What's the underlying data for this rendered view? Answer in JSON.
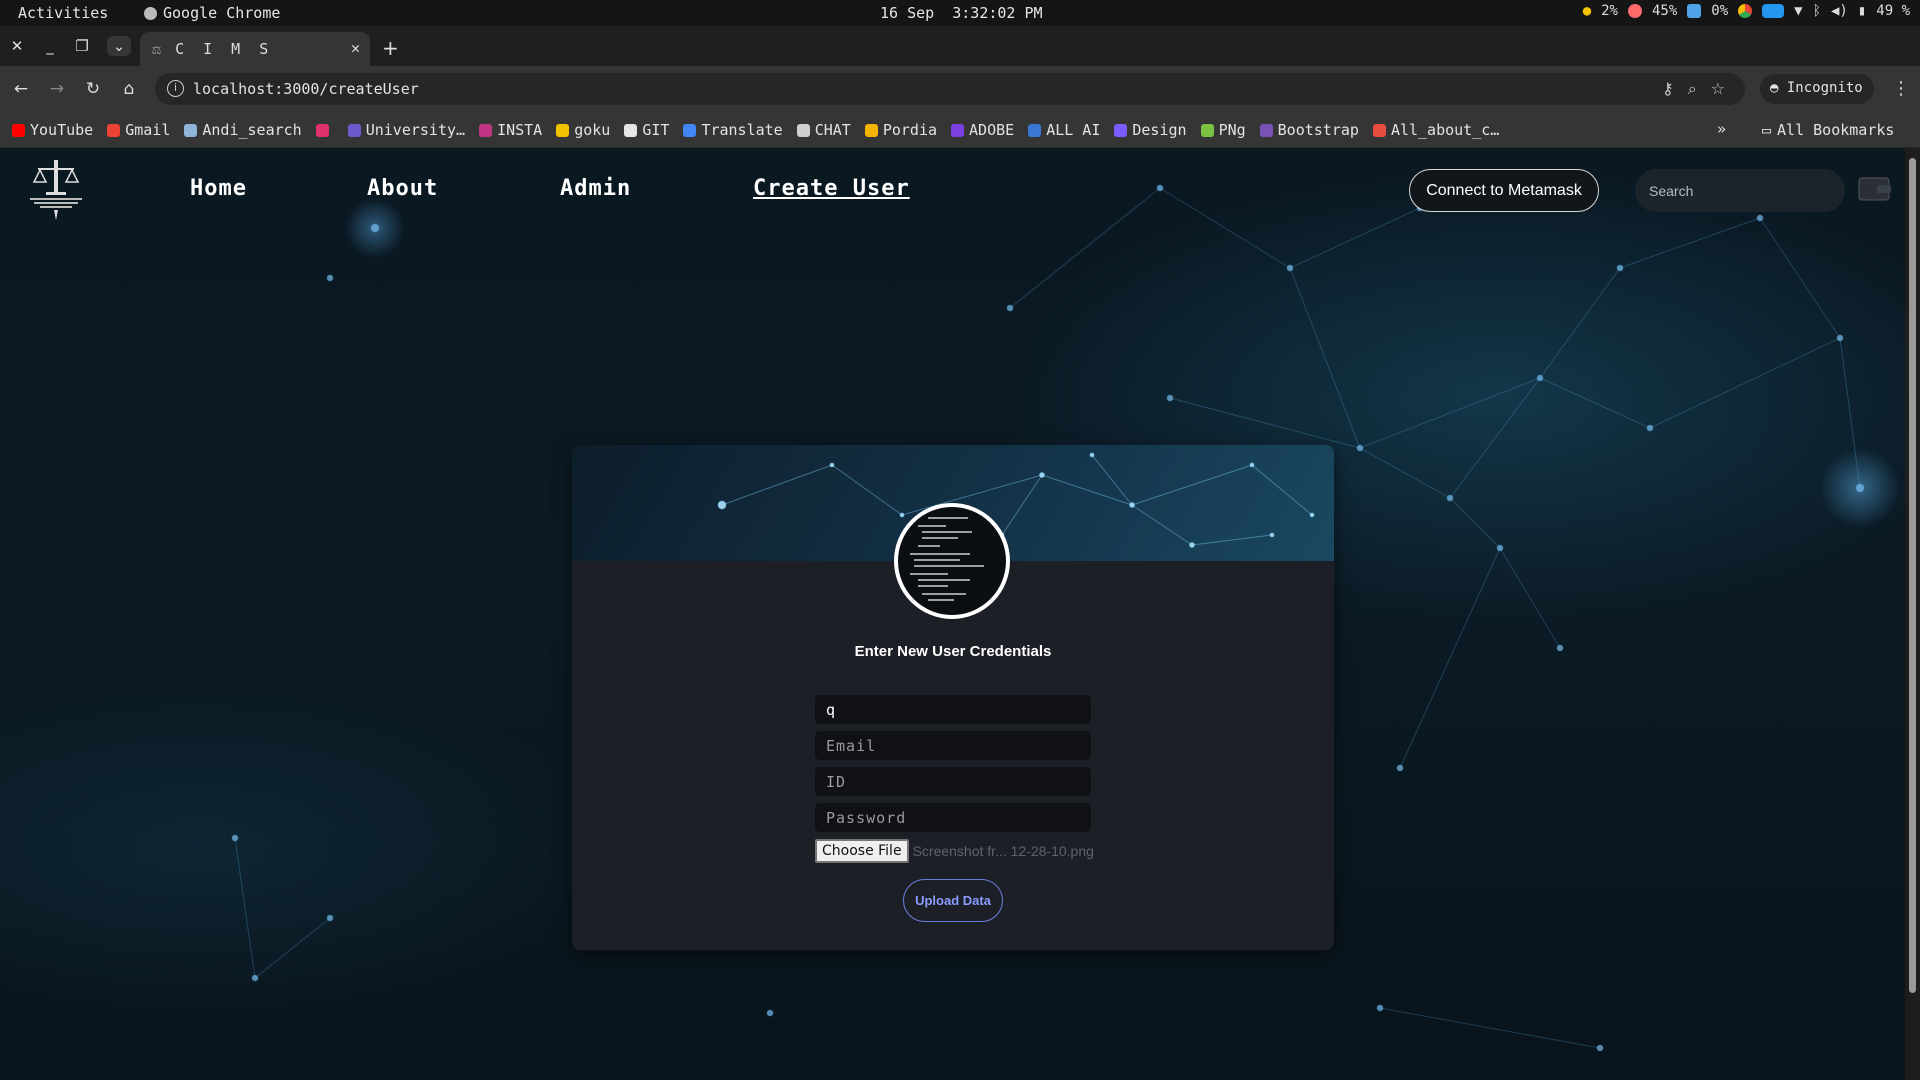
{
  "system_bar": {
    "activities": "Activities",
    "app_name": "Google Chrome",
    "date": "16 Sep",
    "time": "3:32:02 PM",
    "cpu": "2%",
    "mem": "45%",
    "swap": "0%",
    "battery": "49 %"
  },
  "browser": {
    "tab_title": "C I M S",
    "url": "localhost:3000/createUser",
    "incognito_label": "Incognito",
    "bookmarks": [
      {
        "label": "YouTube",
        "color": "#ff0000"
      },
      {
        "label": "Gmail",
        "color": "#ea4335"
      },
      {
        "label": "Andi_search",
        "color": "#8fb4d9"
      },
      {
        "label": "",
        "color": "#e1306c"
      },
      {
        "label": "University…",
        "color": "#6a5acd"
      },
      {
        "label": "INSTA",
        "color": "#c13584"
      },
      {
        "label": "goku",
        "color": "#f2c200"
      },
      {
        "label": "GIT",
        "color": "#e6e6e6"
      },
      {
        "label": "Translate",
        "color": "#4285f4"
      },
      {
        "label": "CHAT",
        "color": "#cfcfcf"
      },
      {
        "label": "Pordia",
        "color": "#f4b400"
      },
      {
        "label": "ADOBE",
        "color": "#7b3fe4"
      },
      {
        "label": "ALL AI",
        "color": "#3a78d8"
      },
      {
        "label": "Design",
        "color": "#7c5cff"
      },
      {
        "label": "PNg",
        "color": "#7cc242"
      },
      {
        "label": "Bootstrap",
        "color": "#7952b3"
      },
      {
        "label": "All_about_c…",
        "color": "#e84d3d"
      }
    ],
    "all_bookmarks": "All Bookmarks"
  },
  "site": {
    "nav": {
      "home": "Home",
      "about": "About",
      "admin": "Admin",
      "create_user": "Create User"
    },
    "connect_button": "Connect to Metamask",
    "search_placeholder": "Search"
  },
  "form": {
    "title": "Enter New User Credentials",
    "name_value": "q",
    "email_placeholder": "Email",
    "id_placeholder": "ID",
    "password_placeholder": "Password",
    "choose_file_label": "Choose File",
    "file_name": "Screenshot fr... 12-28-10.png",
    "upload_label": "Upload Data"
  }
}
